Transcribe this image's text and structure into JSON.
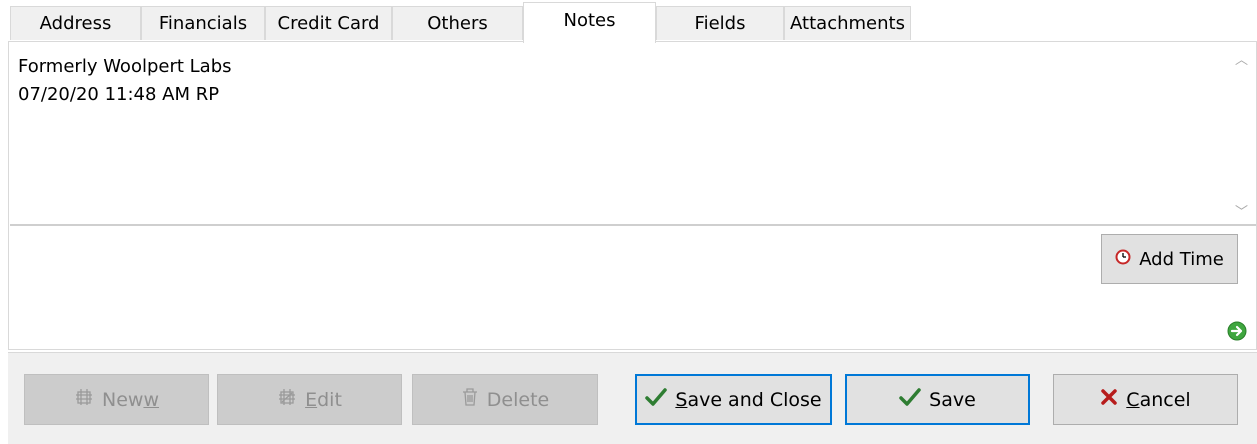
{
  "tabs": [
    {
      "label": "Address"
    },
    {
      "label": "Financials"
    },
    {
      "label": "Credit Card"
    },
    {
      "label": "Others"
    },
    {
      "label": "Notes",
      "active": true
    },
    {
      "label": "Fields"
    },
    {
      "label": "Attachments"
    }
  ],
  "notes": {
    "text": "Formerly Woolpert Labs\n07/20/20 11:48 AM RP"
  },
  "add_time": {
    "label": "Add Time"
  },
  "buttons": {
    "new": {
      "pre": "New",
      "mnemonic": "w",
      "post": ""
    },
    "edit": {
      "pre": "",
      "mnemonic": "E",
      "post": "dit"
    },
    "delete": {
      "label": "Delete"
    },
    "save_close": {
      "pre": "",
      "mnemonic": "S",
      "post": "ave and Close"
    },
    "save": {
      "label": "Save"
    },
    "cancel": {
      "pre": "",
      "mnemonic": "C",
      "post": "ancel"
    }
  },
  "colors": {
    "accent": "#0078d7",
    "check": "#2e7d32",
    "cancel_x": "#b71c1c",
    "go": "#3fa63f"
  },
  "icons": {
    "add_time": "clock-icon",
    "new": "new-record-icon",
    "edit": "edit-record-icon",
    "delete": "trash-icon",
    "save": "checkmark-icon",
    "cancel": "x-icon",
    "go": "go-arrow-icon"
  }
}
